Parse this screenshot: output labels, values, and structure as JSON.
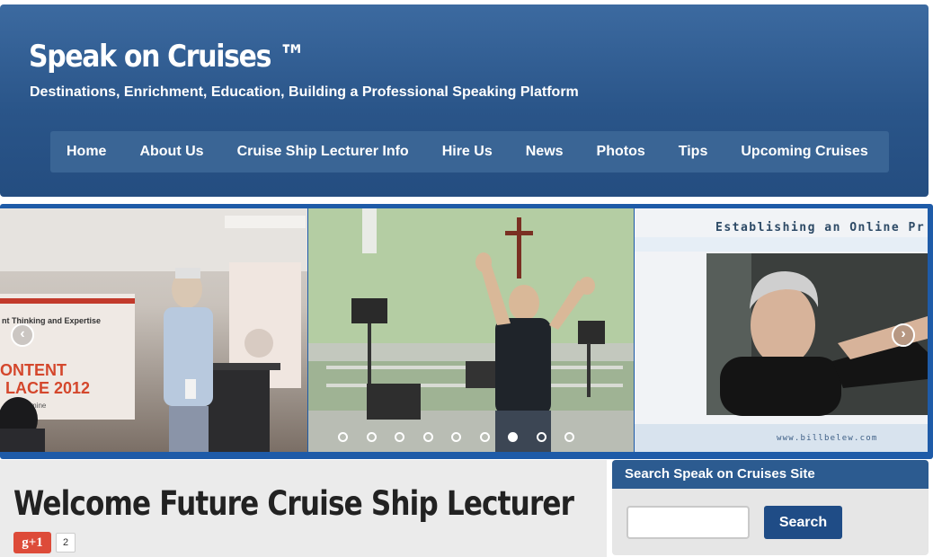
{
  "header": {
    "site_title": "Speak on Cruises ™",
    "tagline": "Destinations, Enrichment, Education, Building a Professional Speaking Platform"
  },
  "nav": {
    "items": [
      {
        "label": "Home"
      },
      {
        "label": "About Us"
      },
      {
        "label": "Cruise Ship Lecturer Info"
      },
      {
        "label": "Hire Us"
      },
      {
        "label": "News"
      },
      {
        "label": "Photos"
      },
      {
        "label": "Tips"
      },
      {
        "label": "Upcoming Cruises"
      }
    ]
  },
  "slider": {
    "slide_count": 9,
    "active_index": 6,
    "prev_icon": "chevron-left-icon",
    "next_icon": "chevron-right-icon",
    "panel_texts": {
      "conference_banner_1": "nt Thinking and Expertise",
      "conference_banner_2": "ONTENT",
      "conference_banner_3": "LACE 2012",
      "conference_banner_4": "nt goldmine",
      "slide_heading": "Establishing an Online Pr",
      "slide_footer": "www.billbelew.com"
    }
  },
  "main": {
    "page_title": "Welcome Future Cruise Ship Lecturer",
    "gplus_label": "g+1",
    "gplus_count": "2"
  },
  "sidebar": {
    "widget_title": "Search Speak on Cruises Site",
    "search_value": "",
    "search_button": "Search"
  },
  "colors": {
    "header_blue": "#2a5589",
    "nav_bg": "#3a6595",
    "slider_border": "#1e5ba8",
    "gplus_red": "#dd4b39",
    "search_button": "#1f4c86"
  }
}
